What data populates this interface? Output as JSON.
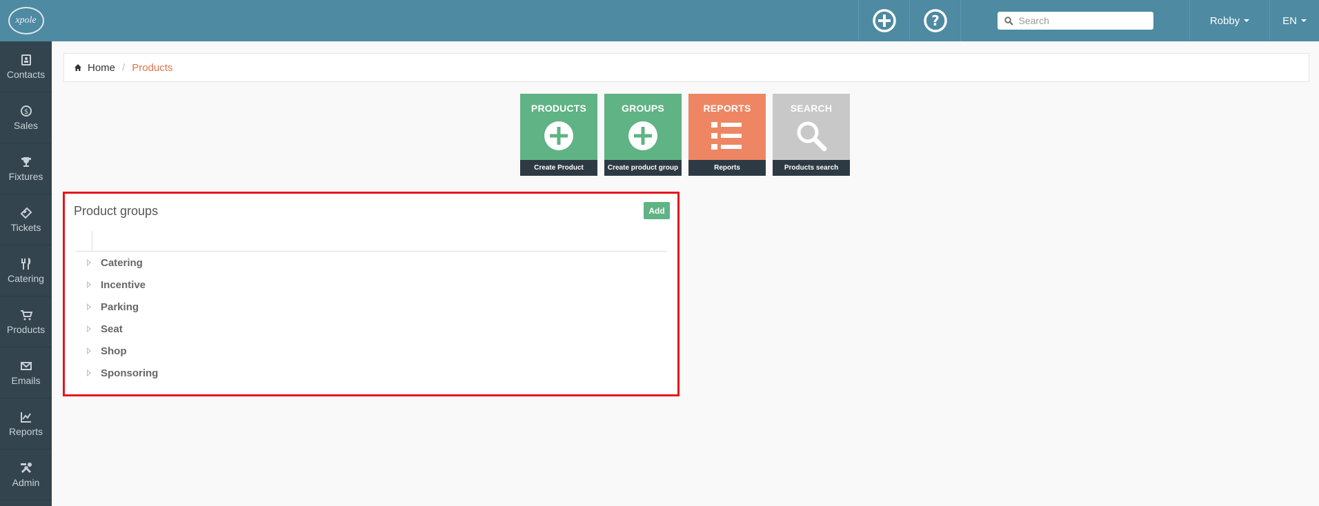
{
  "app": {
    "logo_text": "xpole"
  },
  "sidebar": {
    "items": [
      {
        "label": "Contacts",
        "icon": "contacts-icon"
      },
      {
        "label": "Sales",
        "icon": "dollar-icon"
      },
      {
        "label": "Fixtures",
        "icon": "trophy-icon"
      },
      {
        "label": "Tickets",
        "icon": "ticket-icon"
      },
      {
        "label": "Catering",
        "icon": "cutlery-icon"
      },
      {
        "label": "Products",
        "icon": "cart-icon"
      },
      {
        "label": "Emails",
        "icon": "envelope-icon"
      },
      {
        "label": "Reports",
        "icon": "chart-icon"
      },
      {
        "label": "Admin",
        "icon": "tools-icon"
      }
    ]
  },
  "topbar": {
    "search_placeholder": "Search",
    "user": "Robby",
    "language": "EN"
  },
  "breadcrumb": {
    "home": "Home",
    "current": "Products"
  },
  "tiles": [
    {
      "title": "PRODUCTS",
      "footer": "Create Product",
      "icon": "plus-circle-icon",
      "color": "#5fb384"
    },
    {
      "title": "GROUPS",
      "footer": "Create product group",
      "icon": "plus-circle-icon",
      "color": "#5fb384"
    },
    {
      "title": "REPORTS",
      "footer": "Reports",
      "icon": "list-icon",
      "color": "#ee8663"
    },
    {
      "title": "SEARCH",
      "footer": "Products search",
      "icon": "magnifier-icon",
      "color": "#c8c8c8"
    }
  ],
  "panel": {
    "title": "Product groups",
    "add_label": "Add",
    "groups": [
      "Catering",
      "Incentive",
      "Parking",
      "Seat",
      "Shop",
      "Sponsoring"
    ]
  },
  "colors": {
    "topbar": "#4e8aa2",
    "sidebar": "#34444f",
    "accent_orange": "#e0734e",
    "highlight_border": "#e8141c"
  }
}
